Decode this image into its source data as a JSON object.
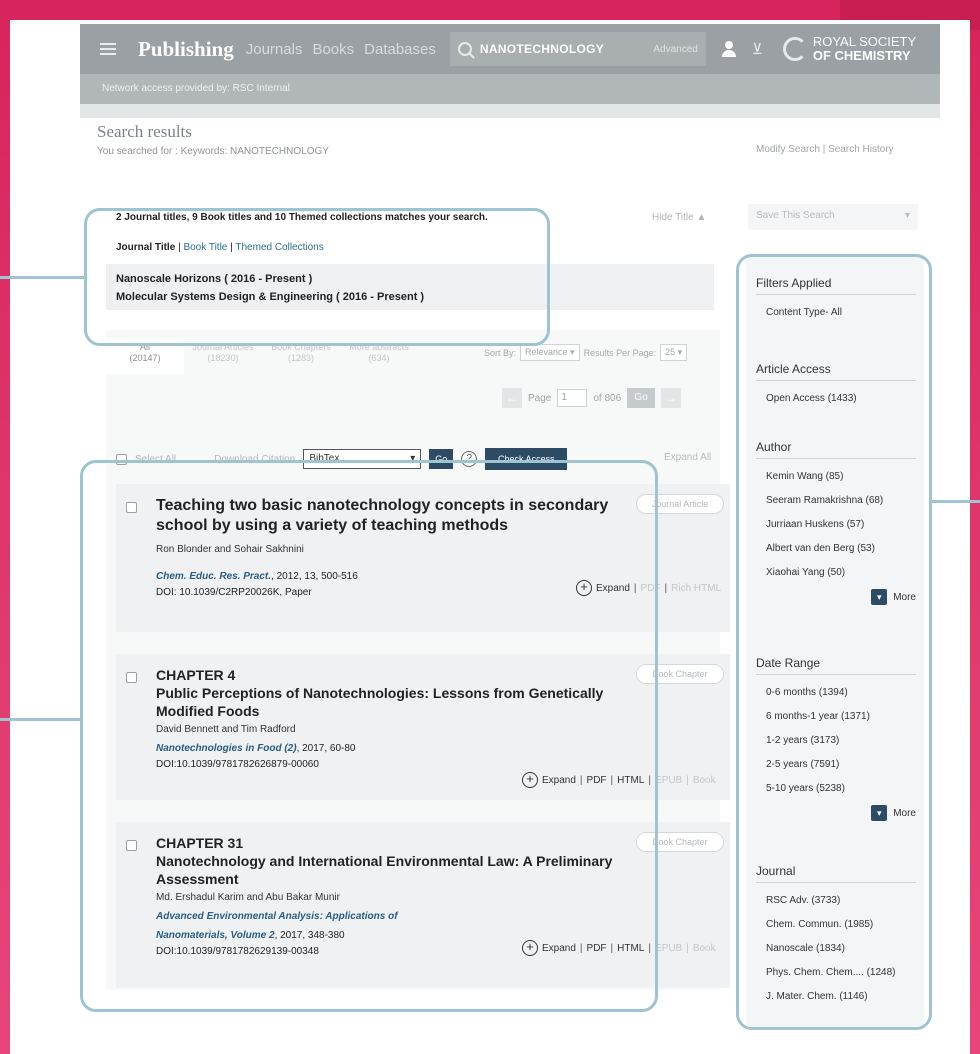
{
  "header": {
    "brand": "Publishing",
    "nav": [
      "Journals",
      "Books",
      "Databases"
    ],
    "search_value": "NANOTECHNOLOGY",
    "advanced": "Advanced",
    "logo_line1": "ROYAL SOCIETY",
    "logo_line2": "OF CHEMISTRY"
  },
  "subheader": {
    "prefix": "Network access provided by: ",
    "org": "RSC Internal"
  },
  "search": {
    "title": "Search results",
    "subtitle": "You searched for : Keywords: NANOTECHNOLOGY",
    "modify": "Modify Search | Search History"
  },
  "matches": {
    "summary": "2 Journal titles, 9 Book titles and 10 Themed collections matches your search.",
    "hide_title": "Hide Title ▲",
    "tab_journal": "Journal Title",
    "tab_book": "Book Title",
    "tab_themed": "Themed Collections",
    "journals": [
      "Nanoscale Horizons ( 2016 - Present )",
      "Molecular Systems Design & Engineering ( 2016 - Present )"
    ]
  },
  "save_search": "Save This Search",
  "type_tabs": [
    {
      "label": "All",
      "count": "(20147)"
    },
    {
      "label": "Journal Articles",
      "count": "(18230)"
    },
    {
      "label": "Book Chapters",
      "count": "(1283)"
    },
    {
      "label": "More abstracts",
      "count": "(634)"
    }
  ],
  "sort": {
    "label": "Sort By:",
    "value": "Relevance",
    "per_page_label": "Results Per Page:",
    "per_page": "25"
  },
  "pager": {
    "page_label": "Page",
    "page": "1",
    "of": "of 806",
    "go": "Go"
  },
  "toolbar": {
    "select_all": "Select All",
    "download_citation": "Download Citation",
    "format": "BibTex",
    "go": "Go",
    "help": "?",
    "check_access": "Check Access",
    "expand_all": "Expand All"
  },
  "results": [
    {
      "chapter": "",
      "title": "Teaching two basic nanotechnology concepts in secondary school by using a variety of teaching methods",
      "authors": "Ron Blonder and Sohair Sakhnini",
      "source": "Chem. Educ. Res. Pract.",
      "source_rest": ", 2012, 13, 500-516",
      "doi": "DOI: 10.1039/C2RP20026K, Paper",
      "badge": "Journal Article",
      "actions": [
        "Expand",
        "PDF",
        "Rich HTML"
      ]
    },
    {
      "chapter": "CHAPTER 4",
      "title": "Public Perceptions of Nanotechnologies: Lessons from Genetically Modified Foods",
      "authors": "David Bennett and Tim Radford",
      "source": "Nanotechnologies in Food (2)",
      "source_rest": ", 2017, 60-80",
      "doi": "DOI:10.1039/9781782626879-00060",
      "badge": "Book Chapter",
      "actions": [
        "Expand",
        "PDF",
        "HTML",
        "EPUB",
        "Book"
      ]
    },
    {
      "chapter": "CHAPTER 31",
      "title": "Nanotechnology and International Environmental Law: A Preliminary Assessment",
      "authors": "Md. Ershadul Karim and Abu Bakar Munir",
      "source": "Advanced Environmental Analysis: Applications of Nanomaterials, Volume 2",
      "source_rest": ", 2017, 348-380",
      "doi": "DOI:10.1039/9781782629139-00348",
      "badge": "Book Chapter",
      "actions": [
        "Expand",
        "PDF",
        "HTML",
        "EPUB",
        "Book"
      ]
    }
  ],
  "filters": {
    "applied": {
      "head": "Filters Applied",
      "items": [
        "Content Type- All"
      ]
    },
    "access": {
      "head": "Article Access",
      "items": [
        "Open Access (1433)"
      ]
    },
    "author": {
      "head": "Author",
      "items": [
        "Kemin Wang (85)",
        "Seeram Ramakrishna (68)",
        "Jurriaan Huskens (57)",
        "Albert van den Berg (53)",
        "Xiaohai Yang (50)"
      ],
      "more": "More"
    },
    "date": {
      "head": "Date Range",
      "items": [
        "0-6 months (1394)",
        "6 months-1 year (1371)",
        "1-2 years (3173)",
        "2-5 years (7591)",
        "5-10 years (5238)"
      ],
      "more": "More"
    },
    "journal": {
      "head": "Journal",
      "items": [
        "RSC Adv. (3733)",
        "Chem. Commun. (1985)",
        "Nanoscale (1834)",
        "Phys. Chem. Chem.... (1248)",
        "J. Mater. Chem. (1146)"
      ]
    }
  },
  "colors": {
    "accent_bg": "#d8255f",
    "highlight": "#9ec3d3",
    "header": "#9aa0a3",
    "link": "#2a5c86"
  }
}
